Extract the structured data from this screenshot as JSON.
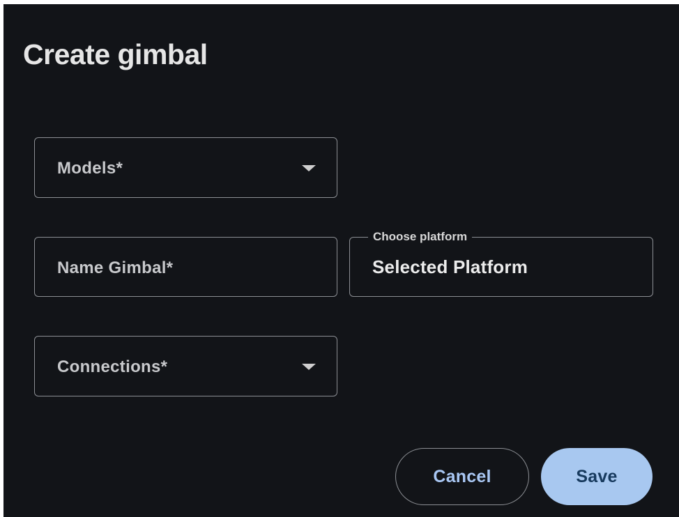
{
  "dialog": {
    "title": "Create gimbal"
  },
  "form": {
    "models": {
      "label": "Models*"
    },
    "name_gimbal": {
      "label": "Name Gimbal*"
    },
    "platform": {
      "floating_label": "Choose platform",
      "value": "Selected Platform"
    },
    "connections": {
      "label": "Connections*"
    }
  },
  "actions": {
    "cancel_label": "Cancel",
    "save_label": "Save"
  },
  "colors": {
    "background": "#121418",
    "border": "#8c8f94",
    "primary": "#a8c8f0",
    "primary_text": "#173a5e",
    "accent_text": "#a9c7f3"
  },
  "icons": {
    "dropdown": "caret-down-icon"
  }
}
